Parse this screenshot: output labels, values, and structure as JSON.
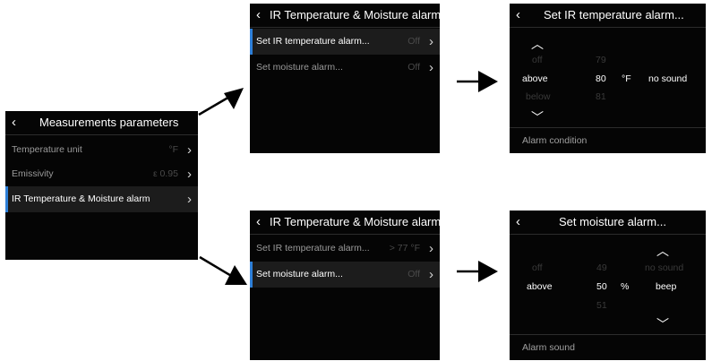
{
  "measurements": {
    "title": "Measurements parameters",
    "rows": [
      {
        "label": "Temperature unit",
        "value": "°F"
      },
      {
        "label": "Emissivity",
        "value": "ε 0.95"
      },
      {
        "label": "IR Temperature & Moisture alarm",
        "value": ""
      }
    ]
  },
  "alarm_menu_top": {
    "title": "IR Temperature & Moisture alarm",
    "rows": [
      {
        "label": "Set IR temperature alarm...",
        "value": "Off"
      },
      {
        "label": "Set moisture alarm...",
        "value": "Off"
      }
    ]
  },
  "alarm_menu_bottom": {
    "title": "IR Temperature & Moisture alarm",
    "rows": [
      {
        "label": "Set IR temperature alarm...",
        "value": "> 77 °F"
      },
      {
        "label": "Set moisture alarm...",
        "value": "Off"
      }
    ]
  },
  "ir_alarm": {
    "title": "Set IR temperature alarm...",
    "condition_prev": "off",
    "condition": "above",
    "condition_next": "below",
    "value_prev": "79",
    "value": "80",
    "value_next": "81",
    "unit": "°F",
    "sound": "no sound",
    "footer": "Alarm condition"
  },
  "moisture_alarm": {
    "title": "Set moisture alarm...",
    "condition_prev": "off",
    "condition": "above",
    "value_prev": "49",
    "value": "50",
    "value_next": "51",
    "unit": "%",
    "sound_prev": "no sound",
    "sound": "beep",
    "footer": "Alarm sound"
  },
  "icons": {
    "back": "‹",
    "chevron_right": "›",
    "chevron_up": "︿",
    "chevron_down": "﹀"
  },
  "colors": {
    "screen_bg": "#050505",
    "selection_bar": "#2d7fd8",
    "arrow": "#000000"
  }
}
